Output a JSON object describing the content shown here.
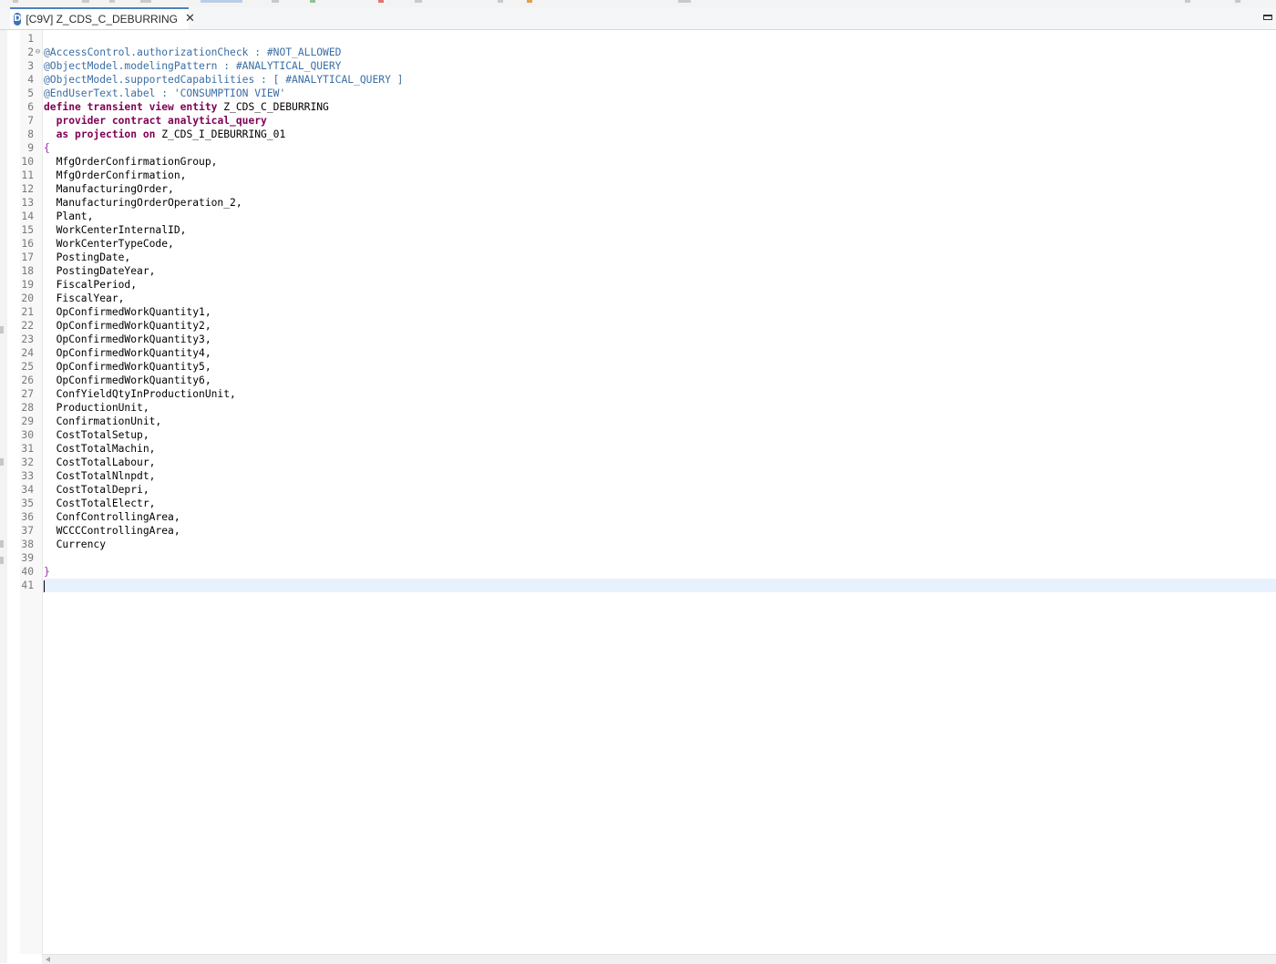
{
  "tab": {
    "title": "[C9V] Z_CDS_C_DEBURRING",
    "icon_letter": "D"
  },
  "colors": {
    "annotation": "#3a6ea5",
    "keyword": "#7f0055",
    "brace": "#9b2fa8",
    "current_line": "#e8f2fe",
    "tab_accent": "#4a82c4"
  },
  "code_lines": [
    {
      "n": "1",
      "tokens": []
    },
    {
      "n": "2",
      "fold": true,
      "tokens": [
        {
          "t": "@AccessControl.authorizationCheck : #NOT_ALLOWED",
          "c": "ann"
        }
      ]
    },
    {
      "n": "3",
      "tokens": [
        {
          "t": "@ObjectModel.modelingPattern : #ANALYTICAL_QUERY",
          "c": "ann"
        }
      ]
    },
    {
      "n": "4",
      "tokens": [
        {
          "t": "@ObjectModel.supportedCapabilities : [ #ANALYTICAL_QUERY ]",
          "c": "ann"
        }
      ]
    },
    {
      "n": "5",
      "tokens": [
        {
          "t": "@EndUserText.label : 'CONSUMPTION VIEW'",
          "c": "ann"
        }
      ]
    },
    {
      "n": "6",
      "tokens": [
        {
          "t": "define transient view entity",
          "c": "kw"
        },
        {
          "t": " Z_CDS_C_DEBURRING"
        }
      ]
    },
    {
      "n": "7",
      "tokens": [
        {
          "t": "  "
        },
        {
          "t": "provider contract analytical_query",
          "c": "kw"
        }
      ]
    },
    {
      "n": "8",
      "tokens": [
        {
          "t": "  "
        },
        {
          "t": "as projection on",
          "c": "kw"
        },
        {
          "t": " Z_CDS_I_DEBURRING_01"
        }
      ]
    },
    {
      "n": "9",
      "tokens": [
        {
          "t": "{",
          "c": "brace"
        }
      ]
    },
    {
      "n": "10",
      "tokens": [
        {
          "t": "  MfgOrderConfirmationGroup,"
        }
      ]
    },
    {
      "n": "11",
      "tokens": [
        {
          "t": "  MfgOrderConfirmation,"
        }
      ]
    },
    {
      "n": "12",
      "tokens": [
        {
          "t": "  ManufacturingOrder,"
        }
      ]
    },
    {
      "n": "13",
      "tokens": [
        {
          "t": "  ManufacturingOrderOperation_2,"
        }
      ]
    },
    {
      "n": "14",
      "tokens": [
        {
          "t": "  Plant,"
        }
      ]
    },
    {
      "n": "15",
      "tokens": [
        {
          "t": "  WorkCenterInternalID,"
        }
      ]
    },
    {
      "n": "16",
      "tokens": [
        {
          "t": "  WorkCenterTypeCode,"
        }
      ]
    },
    {
      "n": "17",
      "tokens": [
        {
          "t": "  PostingDate,"
        }
      ]
    },
    {
      "n": "18",
      "tokens": [
        {
          "t": "  PostingDateYear,"
        }
      ]
    },
    {
      "n": "19",
      "tokens": [
        {
          "t": "  FiscalPeriod,"
        }
      ]
    },
    {
      "n": "20",
      "tokens": [
        {
          "t": "  FiscalYear,"
        }
      ]
    },
    {
      "n": "21",
      "tokens": [
        {
          "t": "  OpConfirmedWorkQuantity1,"
        }
      ]
    },
    {
      "n": "22",
      "tokens": [
        {
          "t": "  OpConfirmedWorkQuantity2,"
        }
      ]
    },
    {
      "n": "23",
      "tokens": [
        {
          "t": "  OpConfirmedWorkQuantity3,"
        }
      ]
    },
    {
      "n": "24",
      "tokens": [
        {
          "t": "  OpConfirmedWorkQuantity4,"
        }
      ]
    },
    {
      "n": "25",
      "tokens": [
        {
          "t": "  OpConfirmedWorkQuantity5,"
        }
      ]
    },
    {
      "n": "26",
      "tokens": [
        {
          "t": "  OpConfirmedWorkQuantity6,"
        }
      ]
    },
    {
      "n": "27",
      "tokens": [
        {
          "t": "  ConfYieldQtyInProductionUnit,"
        }
      ]
    },
    {
      "n": "28",
      "tokens": [
        {
          "t": "  ProductionUnit,"
        }
      ]
    },
    {
      "n": "29",
      "tokens": [
        {
          "t": "  ConfirmationUnit,"
        }
      ]
    },
    {
      "n": "30",
      "tokens": [
        {
          "t": "  CostTotalSetup,"
        }
      ]
    },
    {
      "n": "31",
      "tokens": [
        {
          "t": "  CostTotalMachin,"
        }
      ]
    },
    {
      "n": "32",
      "tokens": [
        {
          "t": "  CostTotalLabour,"
        }
      ]
    },
    {
      "n": "33",
      "tokens": [
        {
          "t": "  CostTotalNlnpdt,"
        }
      ]
    },
    {
      "n": "34",
      "tokens": [
        {
          "t": "  CostTotalDepri,"
        }
      ]
    },
    {
      "n": "35",
      "tokens": [
        {
          "t": "  CostTotalElectr,"
        }
      ]
    },
    {
      "n": "36",
      "tokens": [
        {
          "t": "  ConfControllingArea,"
        }
      ]
    },
    {
      "n": "37",
      "tokens": [
        {
          "t": "  WCCCControllingArea,"
        }
      ]
    },
    {
      "n": "38",
      "tokens": [
        {
          "t": "  Currency"
        }
      ]
    },
    {
      "n": "39",
      "tokens": []
    },
    {
      "n": "40",
      "tokens": [
        {
          "t": "}",
          "c": "brace"
        }
      ]
    },
    {
      "n": "41",
      "current": true,
      "tokens": []
    }
  ]
}
